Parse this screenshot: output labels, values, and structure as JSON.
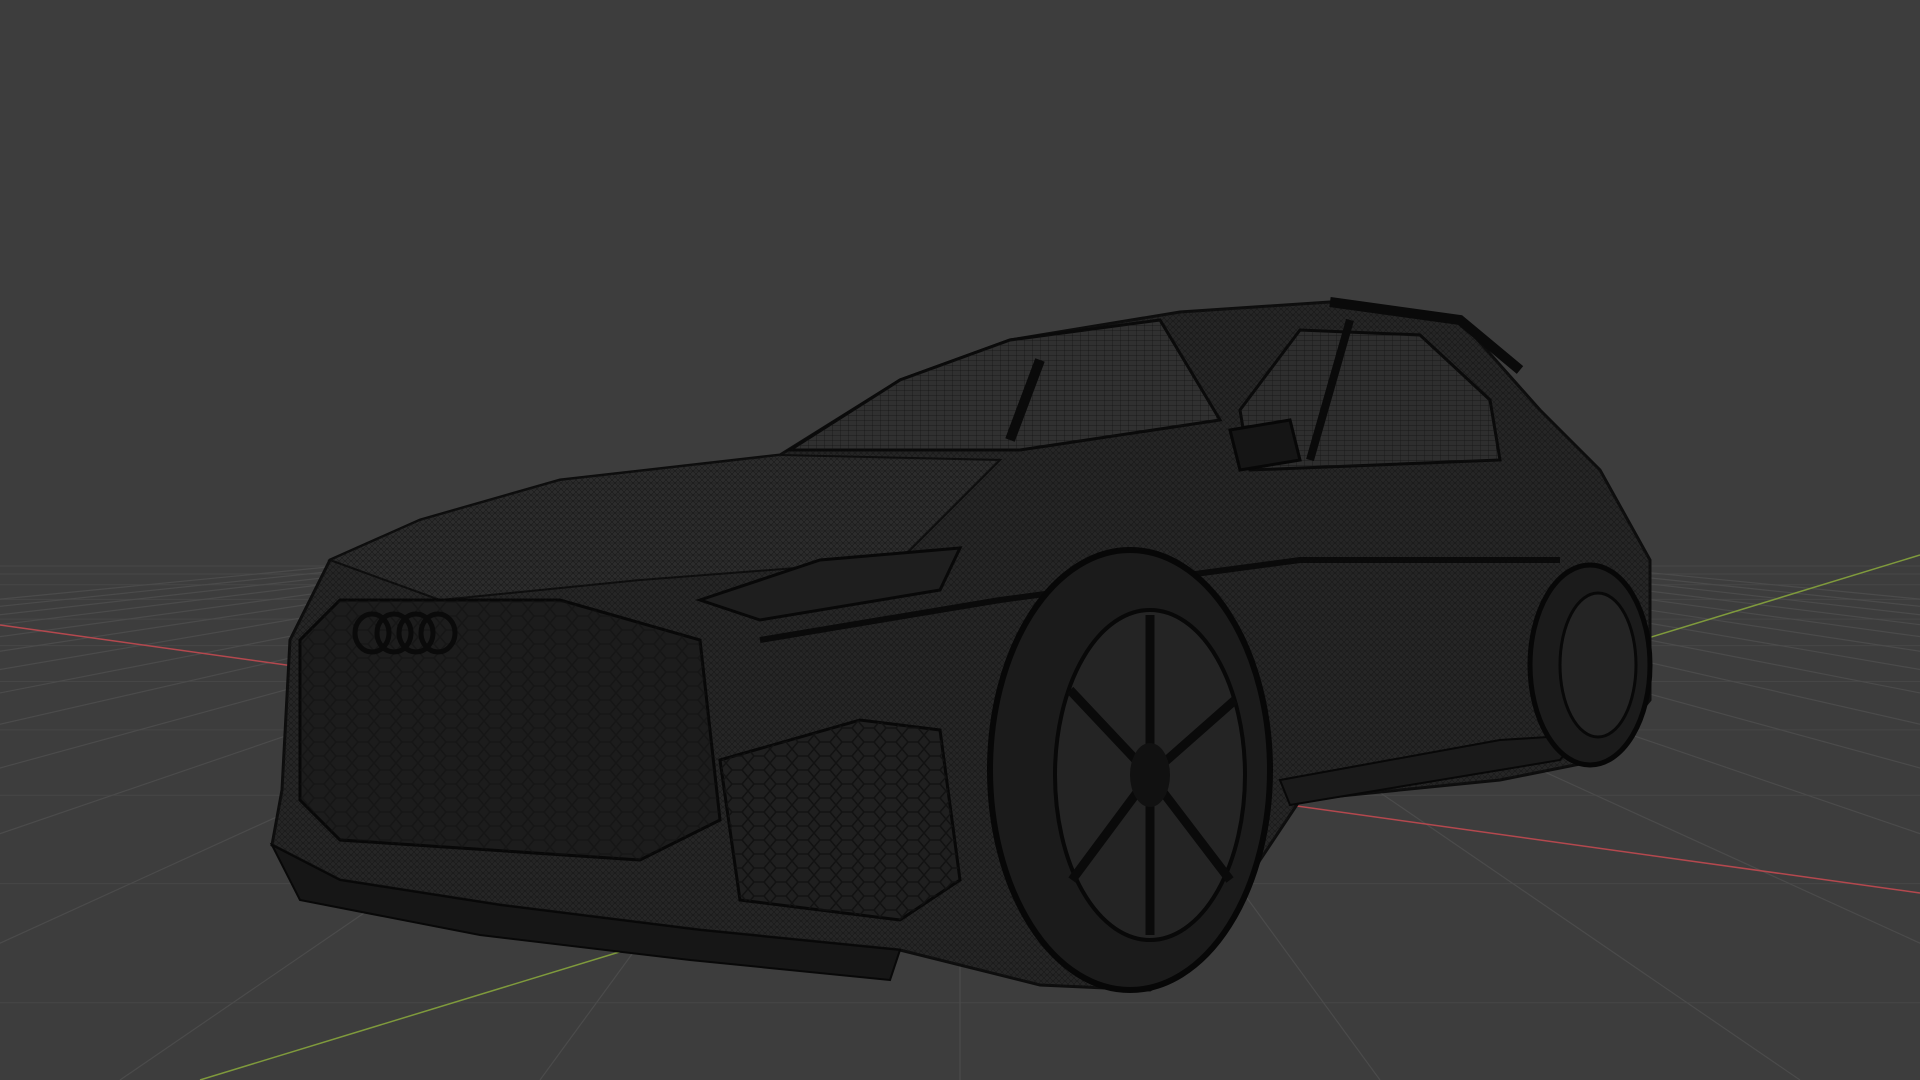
{
  "viewport": {
    "background_color": "#3d3d3d",
    "grid_color": "#4b4b4b",
    "x_axis_color": "#b4484e",
    "y_axis_color": "#7f9a3c",
    "wire_color": "#0f0f0f",
    "body_color": "#2a2a2a",
    "object": "car-wireframe-model",
    "shading_mode": "wireframe"
  }
}
